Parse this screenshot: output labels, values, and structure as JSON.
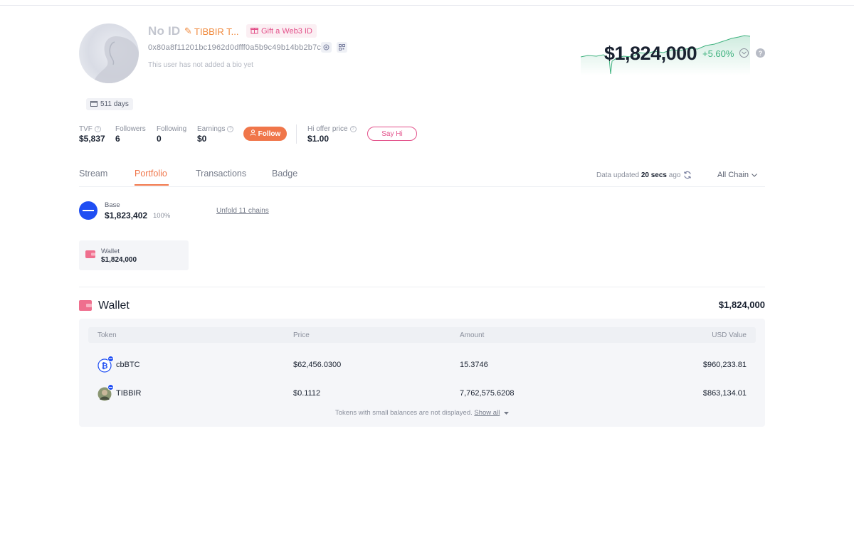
{
  "profile": {
    "name": "No ID",
    "alias": "TIBBIR T...",
    "gift_label": "Gift a Web3 ID",
    "address": "0x80a8f11201bc1962d0dfff0a5b9c49b14bb2b7c2",
    "bio": "This user has not added a bio yet",
    "days": "511 days"
  },
  "stats": {
    "tvf_label": "TVF",
    "tvf_value": "$5,837",
    "followers_label": "Followers",
    "followers_value": "6",
    "following_label": "Following",
    "following_value": "0",
    "earnings_label": "Earnings",
    "earnings_value": "$0",
    "follow_label": "Follow",
    "hi_offer_label": "Hi offer price",
    "hi_offer_value": "$1.00",
    "say_hi_label": "Say Hi"
  },
  "networth": {
    "value": "$1,824,000",
    "change": "+5.60%",
    "accent_color": "#3fb27f"
  },
  "tabs": [
    {
      "label": "Stream"
    },
    {
      "label": "Portfolio",
      "active": true
    },
    {
      "label": "Transactions"
    },
    {
      "label": "Badge"
    }
  ],
  "update_status": {
    "prefix": "Data updated",
    "time": "20 secs",
    "suffix": "ago",
    "chain_filter": "All Chain"
  },
  "chain_summary": {
    "name": "Base",
    "value": "$1,823,402",
    "percent": "100%",
    "unfold_label": "Unfold 11 chains"
  },
  "wallet_card": {
    "label": "Wallet",
    "value": "$1,824,000"
  },
  "wallet_section": {
    "title": "Wallet",
    "total": "$1,824,000",
    "columns": [
      "Token",
      "Price",
      "Amount",
      "USD Value"
    ],
    "rows": [
      {
        "token": "cbBTC",
        "price": "$62,456.0300",
        "amount": "15.3746",
        "usd": "$960,233.81"
      },
      {
        "token": "TIBBIR",
        "price": "$0.1112",
        "amount": "7,762,575.6208",
        "usd": "$863,134.01"
      }
    ],
    "footnote": "Tokens with small balances are not displayed.",
    "show_all": "Show all"
  },
  "colors": {
    "brand_orange": "#f0764a",
    "pink": "#e3508a",
    "base_blue": "#1f4ef3"
  }
}
